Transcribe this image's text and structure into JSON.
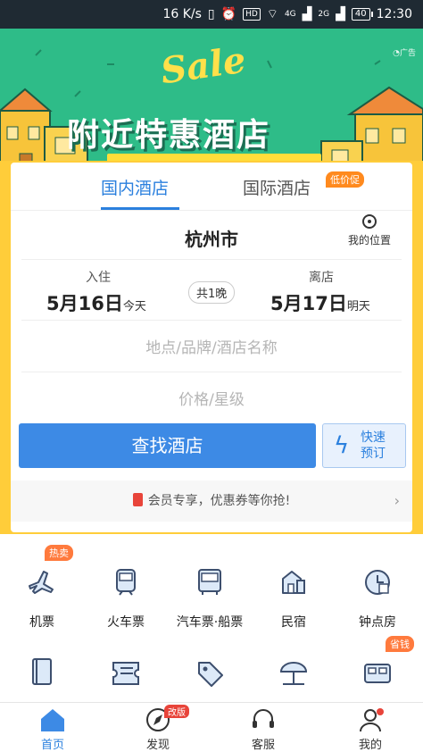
{
  "status_bar": {
    "speed": "16 K/s",
    "hd": "HD",
    "sig4g": "4G",
    "sig2g": "2G",
    "battery": "40",
    "time": "12:30"
  },
  "banner": {
    "sale_word": "Sale",
    "title": "附近特惠酒店",
    "ad_label": "广告"
  },
  "tabs": [
    {
      "label": "国内酒店",
      "active": true
    },
    {
      "label": "国际酒店",
      "active": false
    }
  ],
  "promo_badge": "低价促",
  "city": "杭州市",
  "location_label": "我的位置",
  "checkin": {
    "label": "入住",
    "date": "5月16日",
    "day": "今天"
  },
  "checkout": {
    "label": "离店",
    "date": "5月17日",
    "day": "明天"
  },
  "nights": "共1晚",
  "keyword_placeholder": "地点/品牌/酒店名称",
  "price_placeholder": "价格/星级",
  "search_label": "查找酒店",
  "quick_label_1": "快速",
  "quick_label_2": "预订",
  "member_text": "会员专享，优惠券等你抢!",
  "services": [
    {
      "label": "机票",
      "badge": "热卖",
      "icon": "plane-icon"
    },
    {
      "label": "火车票",
      "badge": "",
      "icon": "train-icon"
    },
    {
      "label": "汽车票·船票",
      "badge": "",
      "icon": "bus-icon"
    },
    {
      "label": "民宿",
      "badge": "",
      "icon": "homestay-icon"
    },
    {
      "label": "钟点房",
      "badge": "",
      "icon": "hourly-room-icon"
    }
  ],
  "services_row2": [
    {
      "icon": "guidebook-icon",
      "badge": ""
    },
    {
      "icon": "ticket-icon",
      "badge": ""
    },
    {
      "icon": "tag-icon",
      "badge": ""
    },
    {
      "icon": "beach-icon",
      "badge": ""
    },
    {
      "icon": "bed-icon",
      "badge": "省钱"
    }
  ],
  "tabbar": [
    {
      "label": "首页",
      "active": true,
      "icon": "home-icon"
    },
    {
      "label": "发现",
      "active": false,
      "badge": "改版",
      "icon": "compass-icon"
    },
    {
      "label": "客服",
      "active": false,
      "icon": "headset-icon"
    },
    {
      "label": "我的",
      "active": false,
      "icon": "user-icon"
    }
  ],
  "colors": {
    "accent": "#2b80de",
    "banner": "#2ebc88",
    "frame": "#ffcd3a",
    "badge": "#ff7a3d"
  }
}
